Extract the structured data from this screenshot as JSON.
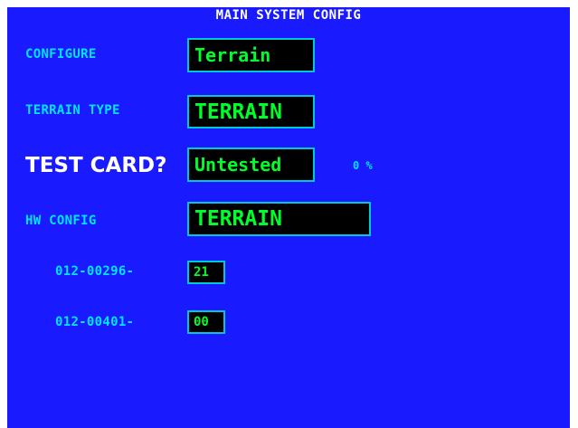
{
  "screen": {
    "title": "MAIN SYSTEM CONFIG"
  },
  "configure": {
    "label": "CONFIGURE",
    "value": "Terrain"
  },
  "terrain_type": {
    "label": "TERRAIN TYPE",
    "value": "TERRAIN"
  },
  "test_card": {
    "label": "TEST CARD?",
    "value": "Untested",
    "percent": "0 %"
  },
  "hw_config": {
    "label": "HW CONFIG",
    "value": "TERRAIN"
  },
  "part_numbers": [
    {
      "label": "012-00296-",
      "value": "21"
    },
    {
      "label": "012-00401-",
      "value": "00"
    }
  ],
  "colors": {
    "background": "#1a1aff",
    "label": "#00e5ff",
    "field_text": "#00ff2a",
    "field_border": "#00c8d8",
    "title": "#ffffff"
  }
}
